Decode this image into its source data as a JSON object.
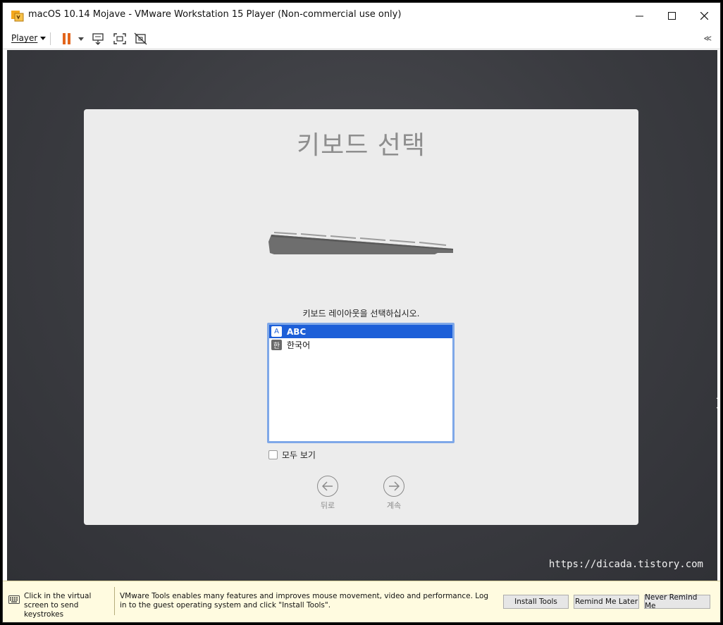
{
  "window": {
    "title": "macOS 10.14 Mojave - VMware Workstation 15 Player (Non-commercial use only)",
    "controls": {
      "minimize": "—",
      "maximize": "☐",
      "close": "✕"
    }
  },
  "toolbar": {
    "player_label": "Player",
    "icons": [
      "pause-icon",
      "dropdown-icon",
      "send-ctrl-alt-del-icon",
      "fullscreen-icon",
      "unity-icon"
    ],
    "collapse_label": "≪",
    "pause_color": "#e2651c"
  },
  "dialog": {
    "title": "키보드 선택",
    "instruction": "키보드 레이아웃을 선택하십시오.",
    "layouts": [
      {
        "badge": "A",
        "label": "ABC",
        "selected": true
      },
      {
        "badge": "한",
        "label": "한국어",
        "selected": false
      }
    ],
    "show_all_label": "모두 보기",
    "back_label": "뒤로",
    "continue_label": "계속",
    "selection_color": "#1d5fd8"
  },
  "watermark": "https://dicada.tistory.com",
  "notification": {
    "keyboard_hint": "Click in the virtual screen to send keystrokes",
    "message": "VMware Tools enables many features and improves mouse movement, video and performance. Log in to the guest operating system and click \"Install Tools\".",
    "buttons": {
      "install": "Install Tools",
      "remind": "Remind Me Later",
      "never": "Never Remind Me"
    }
  }
}
